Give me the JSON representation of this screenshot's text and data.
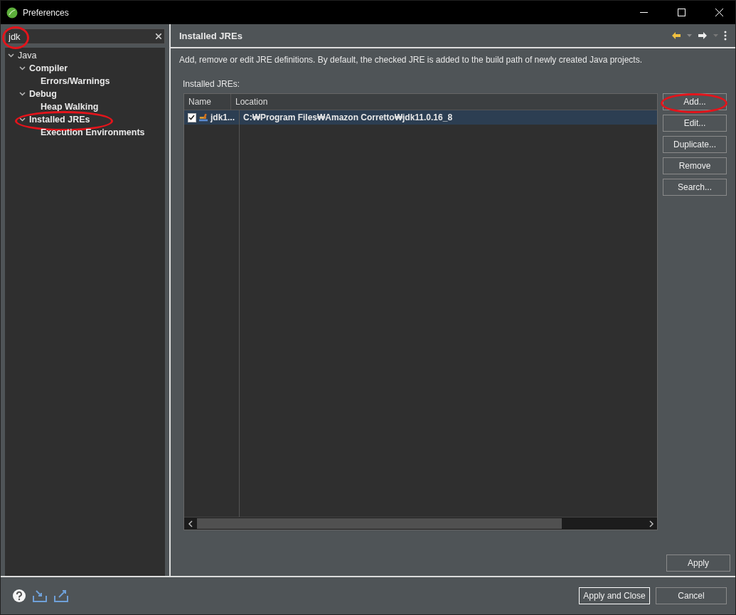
{
  "window": {
    "title": "Preferences"
  },
  "filter": {
    "value": "jdk",
    "highlighted": true
  },
  "tree": [
    {
      "label": "Java",
      "expanded": true,
      "highlighted": false,
      "children": [
        {
          "label": "Compiler",
          "expanded": true,
          "highlighted": false,
          "children": [
            {
              "label": "Errors/Warnings",
              "highlighted": false
            }
          ]
        },
        {
          "label": "Debug",
          "expanded": true,
          "highlighted": false,
          "children": [
            {
              "label": "Heap Walking",
              "highlighted": false
            }
          ]
        },
        {
          "label": "Installed JREs",
          "expanded": true,
          "highlighted": true,
          "children": [
            {
              "label": "Execution Environments",
              "highlighted": false
            }
          ]
        }
      ]
    }
  ],
  "page": {
    "title": "Installed JREs",
    "description": "Add, remove or edit JRE definitions. By default, the checked JRE is added to the build path of newly created Java projects.",
    "table_label": "Installed JREs:"
  },
  "table": {
    "columns": [
      "Name",
      "Location"
    ],
    "rows": [
      {
        "name": "jdk1...",
        "location": "C:₩Program Files₩Amazon Corretto₩jdk11.0.16_8",
        "checked": true,
        "selected": true
      }
    ]
  },
  "side_buttons": [
    {
      "label": "Add...",
      "highlighted": true
    },
    {
      "label": "Edit...",
      "highlighted": false
    },
    {
      "label": "Duplicate...",
      "highlighted": false
    },
    {
      "label": "Remove",
      "highlighted": false
    },
    {
      "label": "Search...",
      "highlighted": false
    }
  ],
  "apply_button": "Apply",
  "footer_buttons": [
    {
      "label": "Apply and Close",
      "default": true
    },
    {
      "label": "Cancel",
      "default": false
    }
  ]
}
